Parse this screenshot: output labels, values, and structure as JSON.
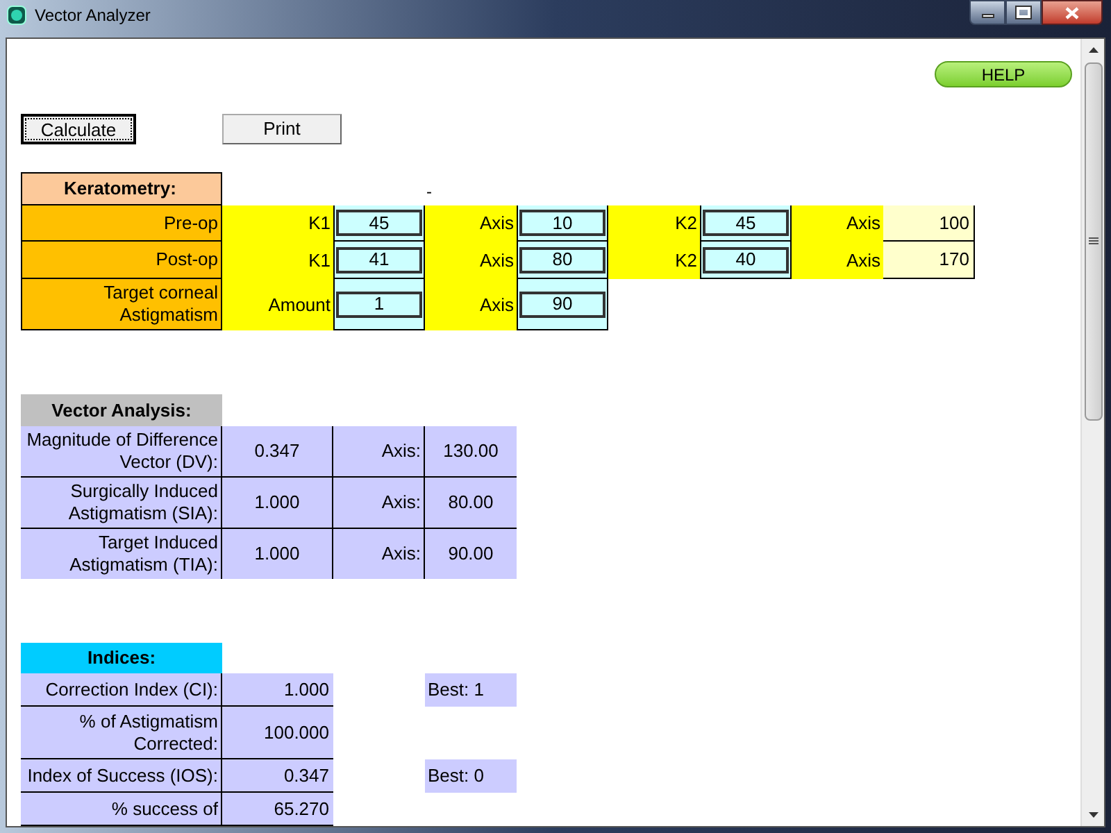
{
  "window": {
    "title": "Vector Analyzer"
  },
  "help_button": "HELP",
  "buttons": [
    {
      "label": "Calculate",
      "focused": true
    },
    {
      "label": "Print",
      "focused": false
    }
  ],
  "keratometry": {
    "title": "Keratometry:",
    "marker": "-",
    "rows": [
      {
        "label": "Pre-op",
        "pairs": [
          {
            "label": "K1",
            "value": "45",
            "kind": "input"
          },
          {
            "label": "Axis",
            "value": "10",
            "kind": "input"
          },
          {
            "label": "K2",
            "value": "45",
            "kind": "input"
          },
          {
            "label": "Axis",
            "value": "100",
            "kind": "output"
          }
        ]
      },
      {
        "label": "Post-op",
        "pairs": [
          {
            "label": "K1",
            "value": "41",
            "kind": "input"
          },
          {
            "label": "Axis",
            "value": "80",
            "kind": "input"
          },
          {
            "label": "K2",
            "value": "40",
            "kind": "input"
          },
          {
            "label": "Axis",
            "value": "170",
            "kind": "output"
          }
        ]
      },
      {
        "label": "Target corneal Astigmatism",
        "pairs": [
          {
            "label": "Amount",
            "value": "1",
            "kind": "input"
          },
          {
            "label": "Axis",
            "value": "90",
            "kind": "input"
          }
        ]
      }
    ]
  },
  "vector_analysis": {
    "title": "Vector Analysis:",
    "rows": [
      {
        "label": "Magnitude of Difference Vector (DV):",
        "value": "0.347",
        "axis_label": "Axis:",
        "axis_value": "130.00"
      },
      {
        "label": "Surgically Induced Astigmatism (SIA):",
        "value": "1.000",
        "axis_label": "Axis:",
        "axis_value": "80.00"
      },
      {
        "label": "Target Induced Astigmatism (TIA):",
        "value": "1.000",
        "axis_label": "Axis:",
        "axis_value": "90.00"
      }
    ]
  },
  "indices": {
    "title": "Indices:",
    "rows": [
      {
        "label": "Correction Index (CI):",
        "value": "1.000",
        "best": "Best: 1"
      },
      {
        "label": "% of Astigmatism Corrected:",
        "value": "100.000"
      },
      {
        "label": "Index of Success (IOS):",
        "value": "0.347",
        "best": "Best: 0"
      },
      {
        "label": "% success of",
        "value": "65.270"
      }
    ]
  }
}
